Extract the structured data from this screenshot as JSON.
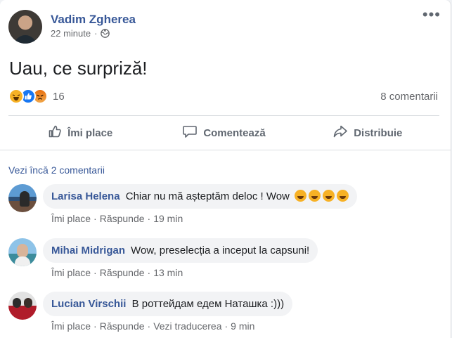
{
  "post": {
    "author": "Vadim Zgherea",
    "time": "22 minute",
    "dot": "·",
    "text": "Uau, ce surpriză!",
    "reaction_count": "16",
    "reactions": [
      "haha",
      "like",
      "angry"
    ],
    "comment_count": "8 comentarii"
  },
  "actions": {
    "like": "Îmi place",
    "comment": "Comentează",
    "share": "Distribuie"
  },
  "more_comments": "Vezi încă 2 comentarii",
  "comments": [
    {
      "name": "Larisa Helena",
      "text": "Chiar nu mă așteptăm deloc ! Wow",
      "emoji_count": 4,
      "like": "Îmi place",
      "reply": "Răspunde",
      "time": "19 min"
    },
    {
      "name": "Mihai Midrigan",
      "text": "Wow, preselecția a inceput la capsuni!",
      "like": "Îmi place",
      "reply": "Răspunde",
      "time": "13 min"
    },
    {
      "name": "Lucian Virschii",
      "text": "В роттейдам едем Наташка :)))",
      "like": "Îmi place",
      "reply": "Răspunde",
      "translate": "Vezi traducerea",
      "time": "9 min"
    }
  ],
  "colors": {
    "link": "#385898",
    "secondary": "#65676b",
    "bubble": "#f2f3f5",
    "divider": "#dadde1"
  },
  "icons": [
    "globe-icon",
    "more-icon",
    "haha-icon",
    "like-icon",
    "angry-icon",
    "thumbs-up-icon",
    "comment-icon",
    "share-icon",
    "laughing-emoji-icon"
  ]
}
